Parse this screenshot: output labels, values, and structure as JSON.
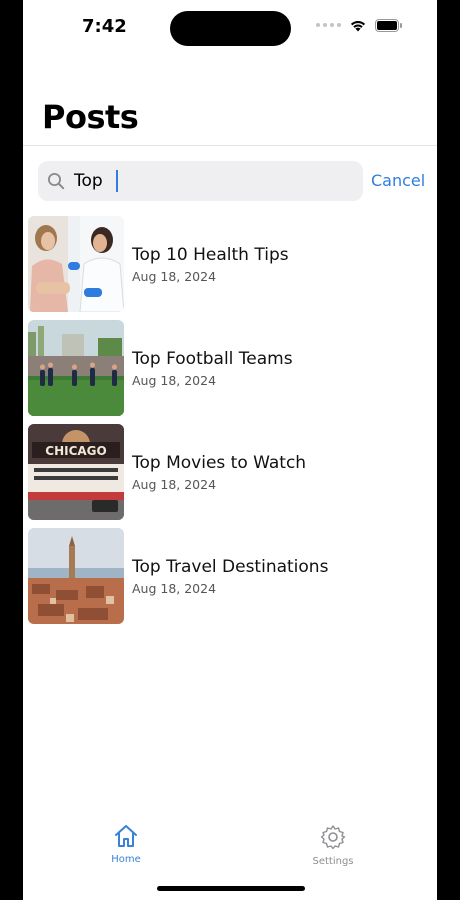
{
  "status_bar": {
    "time": "7:42"
  },
  "header": {
    "title": "Posts"
  },
  "search": {
    "value": "Top",
    "cancel_label": "Cancel"
  },
  "posts": [
    {
      "title": "Top 10 Health Tips",
      "date": "Aug 18, 2024",
      "image": "doctor-patient-photo"
    },
    {
      "title": "Top Football Teams",
      "date": "Aug 18, 2024",
      "image": "football-players-photo"
    },
    {
      "title": "Top Movies to Watch",
      "date": "Aug 18, 2024",
      "image": "chicago-theater-photo"
    },
    {
      "title": "Top Travel Destinations",
      "date": "Aug 18, 2024",
      "image": "venice-city-photo"
    }
  ],
  "tab_bar": {
    "home_label": "Home",
    "settings_label": "Settings",
    "active_color": "#3a82d6",
    "inactive_color": "#8e8e93"
  },
  "theme": {
    "accent": "#2f7de0",
    "search_bg": "#efeff1"
  },
  "thumb_words": {
    "chicago": "CHICAGO"
  }
}
